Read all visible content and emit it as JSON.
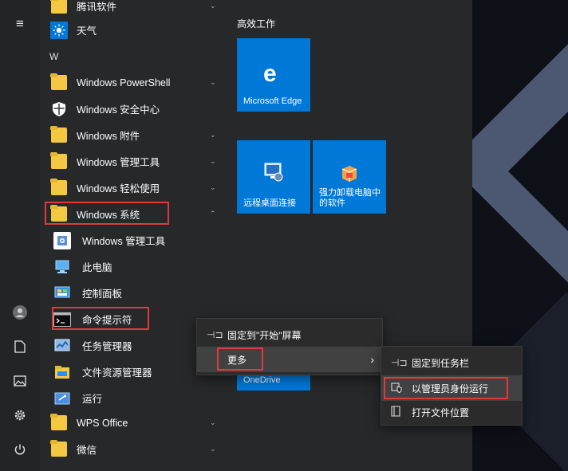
{
  "rail": {
    "menu_icon": "≡"
  },
  "apps": {
    "top_partial": "腾讯软件",
    "weather": "天气",
    "letter": "W",
    "powershell": "Windows PowerShell",
    "security": "Windows 安全中心",
    "accessories": "Windows 附件",
    "admin_tools": "Windows 管理工具",
    "ease": "Windows 轻松使用",
    "system": "Windows 系统",
    "sys_admin": "Windows 管理工具",
    "this_pc": "此电脑",
    "control_panel": "控制面板",
    "cmd": "命令提示符",
    "task_manager": "任务管理器",
    "explorer": "文件资源管理器",
    "run": "运行",
    "wps": "WPS Office",
    "wechat": "微信"
  },
  "tiles": {
    "group_title": "高效工作",
    "edge": "Microsoft Edge",
    "rdp": "远程桌面连接",
    "uninstall_line1": "强力卸载电脑中",
    "uninstall_line2": "的软件",
    "onedrive": "OneDrive"
  },
  "context_menu": {
    "pin_start": "固定到\"开始\"屏幕",
    "more": "更多"
  },
  "submenu": {
    "pin_taskbar": "固定到任务栏",
    "run_admin": "以管理员身份运行",
    "open_location": "打开文件位置"
  },
  "colors": {
    "accent": "#0078d7",
    "highlight": "#e03a3a",
    "folder": "#f5c842"
  }
}
